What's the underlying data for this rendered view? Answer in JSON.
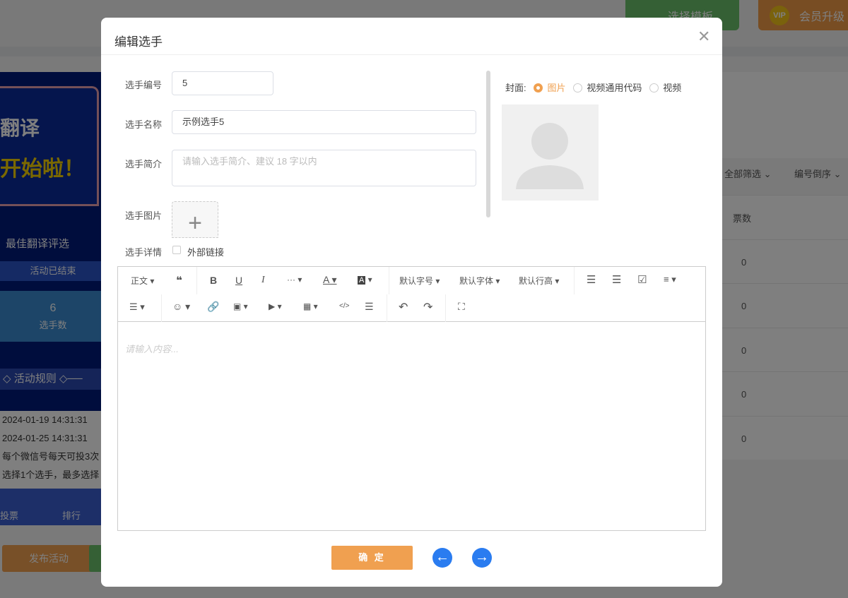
{
  "background": {
    "template_button": "选择模板",
    "vip_badge": "VIP",
    "vip_button": "会员升级",
    "phone": {
      "banner_line1": "翻译",
      "banner_line2": "开始啦！",
      "title": "最佳翻译评选",
      "status": "活动已结束",
      "stat_value": "6",
      "stat_label": "选手数",
      "rules": "活动规则",
      "start_time": "2024-01-19 14:31:31",
      "end_time": "2024-01-25 14:31:31",
      "rule1": "每个微信号每天可投3次",
      "rule2": "选择1个选手，最多选择",
      "nav_vote": "投票",
      "nav_rank": "排行"
    },
    "publish_button": "发布活动",
    "filter_all": "全部筛选",
    "sort_order": "编号倒序",
    "votes_header": "票数",
    "votes": [
      "0",
      "0",
      "0",
      "0",
      "0"
    ]
  },
  "modal": {
    "title": "编辑选手",
    "fields": {
      "number_label": "选手编号",
      "number_value": "5",
      "name_label": "选手名称",
      "name_value": "示例选手5",
      "intro_label": "选手简介",
      "intro_placeholder": "请输入选手简介、建议 18 字以内",
      "image_label": "选手图片",
      "detail_label": "选手详情",
      "external_link": "外部链接"
    },
    "cover": {
      "label": "封面:",
      "options": [
        "图片",
        "视频通用代码",
        "视频"
      ],
      "selected": "图片"
    },
    "editor": {
      "toolbar": {
        "paragraph": "正文",
        "font_size": "默认字号",
        "font_family": "默认字体",
        "line_height": "默认行高"
      },
      "placeholder": "请输入内容..."
    },
    "confirm": "确 定"
  },
  "colors": {
    "accent": "#f0a050",
    "primary": "#2a7cf0"
  }
}
